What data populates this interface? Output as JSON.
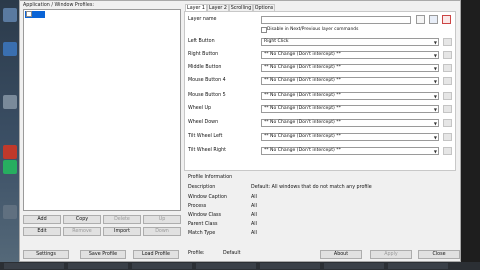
{
  "window": {
    "profiles_title": "Application / Window Profiles:",
    "profiles": [
      {
        "label": "Default",
        "selected": true
      }
    ],
    "profile_buttons": {
      "add": "Add",
      "copy": "Copy",
      "delete": "Delete",
      "up": "Up",
      "edit": "Edit",
      "remove": "Remove",
      "import": "Import",
      "down": "Down"
    },
    "bottom_bar": {
      "settings": "Settings",
      "save_profile": "Save Profile",
      "load_profile": "Load Profile",
      "profile_label": "Profile:",
      "profile_value": "Default",
      "about": "About",
      "apply": "Apply",
      "close": "Close"
    }
  },
  "tabs": [
    {
      "label": "Layer 1",
      "active": true
    },
    {
      "label": "Layer 2",
      "active": false
    },
    {
      "label": "Scrolling",
      "active": false
    },
    {
      "label": "Options",
      "active": false
    }
  ],
  "layer": {
    "name_label": "Layer name",
    "disable_label": "Disable in Next/Previous layer commands",
    "rows": [
      {
        "label": "Left Button",
        "value": "Right Click"
      },
      {
        "label": "Right Button",
        "value": "** No Change (Don't intercept) **"
      },
      {
        "label": "Middle Button",
        "value": "** No Change (Don't intercept) **"
      },
      {
        "label": "Mouse Button 4",
        "value": "** No Change (Don't intercept) **"
      },
      {
        "label": "Mouse Button 5",
        "value": "** No Change (Don't intercept) **"
      },
      {
        "label": "Wheel Up",
        "value": "** No Change (Don't intercept) **"
      },
      {
        "label": "Wheel Down",
        "value": "** No Change (Don't intercept) **"
      },
      {
        "label": "Tilt Wheel Left",
        "value": "** No Change (Don't intercept) **"
      },
      {
        "label": "Tilt Wheel Right",
        "value": "** No Change (Don't intercept) **"
      }
    ]
  },
  "profile_info": {
    "title": "Profile Information",
    "rows": [
      {
        "key": "Description",
        "value": "Default: All windows that do not match any profile"
      },
      {
        "key": "Window Caption",
        "value": "All"
      },
      {
        "key": "Process",
        "value": "All"
      },
      {
        "key": "Window Class",
        "value": "All"
      },
      {
        "key": "Parent Class",
        "value": "All"
      },
      {
        "key": "Match Type",
        "value": "All"
      }
    ]
  },
  "colors": {
    "accent": "#0a64d6",
    "window_bg": "#f0f0f0"
  }
}
